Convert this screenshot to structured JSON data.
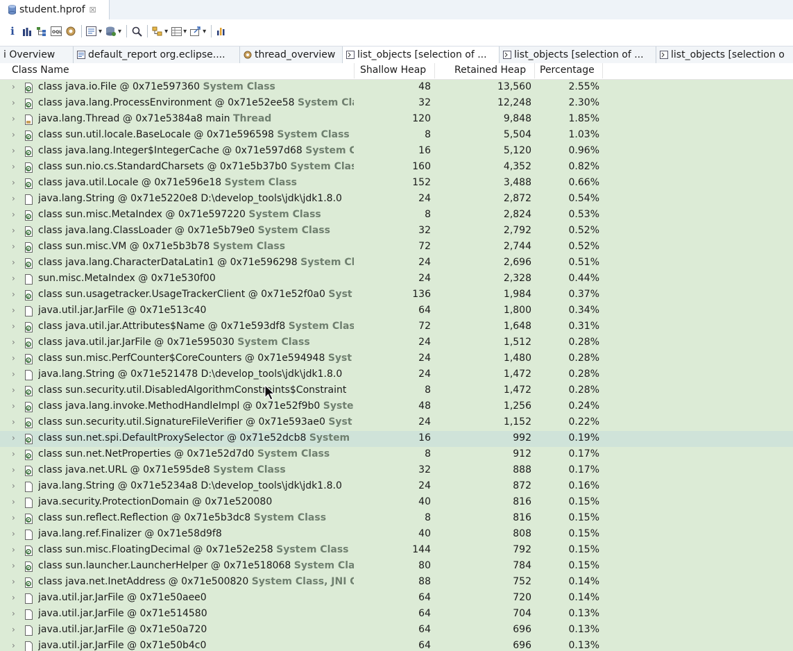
{
  "editor_tab": {
    "title": "student.hprof",
    "close_glyph": "☒"
  },
  "toolbar": {
    "items": [
      "info-icon",
      "histogram-icon",
      "dominator-tree-icon",
      "oql-icon",
      "thread-overview-icon",
      "run-report-icon",
      "query-browser-icon",
      "find-object-icon",
      "group-by-icon",
      "calculate-heap-icon",
      "export-icon",
      "overview-icon"
    ],
    "info_glyph": "i"
  },
  "result_tabs": [
    {
      "label": "i Overview",
      "icon": "info-icon"
    },
    {
      "label": "default_report  org.eclipse....",
      "icon": "report-icon"
    },
    {
      "label": "thread_overview",
      "icon": "gear-icon"
    },
    {
      "label": "list_objects  [selection of ...",
      "icon": "list-icon",
      "active": true
    },
    {
      "label": "list_objects  [selection of ...",
      "icon": "list-icon"
    },
    {
      "label": "list_objects  [selection o",
      "icon": "list-icon"
    }
  ],
  "columns": {
    "class_name": "Class Name",
    "shallow_heap": "Shallow Heap",
    "retained_heap": "Retained Heap",
    "percentage": "Percentage"
  },
  "rows": [
    {
      "name": "class java.io.File @ 0x71e597360",
      "extra": "System Class",
      "shallow": "48",
      "retained": "13,560",
      "pct": "2.55%",
      "kind": "class"
    },
    {
      "name": "class java.lang.ProcessEnvironment @ 0x71e52ee58",
      "extra": "System Cla",
      "shallow": "32",
      "retained": "12,248",
      "pct": "2.30%",
      "kind": "class"
    },
    {
      "name": "java.lang.Thread @ 0x71e5384a8  main",
      "extra": "Thread",
      "shallow": "120",
      "retained": "9,848",
      "pct": "1.85%",
      "kind": "thread"
    },
    {
      "name": "class sun.util.locale.BaseLocale @ 0x71e596598",
      "extra": "System Class",
      "shallow": "8",
      "retained": "5,504",
      "pct": "1.03%",
      "kind": "class"
    },
    {
      "name": "class java.lang.Integer$IntegerCache @ 0x71e597d68",
      "extra": "System C",
      "shallow": "16",
      "retained": "5,120",
      "pct": "0.96%",
      "kind": "class"
    },
    {
      "name": "class sun.nio.cs.StandardCharsets @ 0x71e5b37b0",
      "extra": "System Clas",
      "shallow": "160",
      "retained": "4,352",
      "pct": "0.82%",
      "kind": "class"
    },
    {
      "name": "class java.util.Locale @ 0x71e596e18",
      "extra": "System Class",
      "shallow": "152",
      "retained": "3,488",
      "pct": "0.66%",
      "kind": "class"
    },
    {
      "name": "java.lang.String @ 0x71e5220e8  D:\\develop_tools\\jdk\\jdk1.8.0",
      "extra": "",
      "shallow": "24",
      "retained": "2,872",
      "pct": "0.54%",
      "kind": "object"
    },
    {
      "name": "class sun.misc.MetaIndex @ 0x71e597220",
      "extra": "System Class",
      "shallow": "8",
      "retained": "2,824",
      "pct": "0.53%",
      "kind": "class"
    },
    {
      "name": "class java.lang.ClassLoader @ 0x71e5b79e0",
      "extra": "System Class",
      "shallow": "32",
      "retained": "2,792",
      "pct": "0.52%",
      "kind": "class"
    },
    {
      "name": "class sun.misc.VM @ 0x71e5b3b78",
      "extra": "System Class",
      "shallow": "72",
      "retained": "2,744",
      "pct": "0.52%",
      "kind": "class"
    },
    {
      "name": "class java.lang.CharacterDataLatin1 @ 0x71e596298",
      "extra": "System Cla",
      "shallow": "24",
      "retained": "2,696",
      "pct": "0.51%",
      "kind": "class"
    },
    {
      "name": "sun.misc.MetaIndex @ 0x71e530f00",
      "extra": "",
      "shallow": "24",
      "retained": "2,328",
      "pct": "0.44%",
      "kind": "object"
    },
    {
      "name": "class sun.usagetracker.UsageTrackerClient @ 0x71e52f0a0",
      "extra": "Syst",
      "shallow": "136",
      "retained": "1,984",
      "pct": "0.37%",
      "kind": "class"
    },
    {
      "name": "java.util.jar.JarFile @ 0x71e513c40",
      "extra": "",
      "shallow": "64",
      "retained": "1,800",
      "pct": "0.34%",
      "kind": "object"
    },
    {
      "name": "class java.util.jar.Attributes$Name @ 0x71e593df8",
      "extra": "System Clas",
      "shallow": "72",
      "retained": "1,648",
      "pct": "0.31%",
      "kind": "class"
    },
    {
      "name": "class java.util.jar.JarFile @ 0x71e595030",
      "extra": "System Class",
      "shallow": "24",
      "retained": "1,512",
      "pct": "0.28%",
      "kind": "class"
    },
    {
      "name": "class sun.misc.PerfCounter$CoreCounters @ 0x71e594948",
      "extra": "Syst",
      "shallow": "24",
      "retained": "1,480",
      "pct": "0.28%",
      "kind": "class"
    },
    {
      "name": "java.lang.String @ 0x71e521478  D:\\develop_tools\\jdk\\jdk1.8.0",
      "extra": "",
      "shallow": "24",
      "retained": "1,472",
      "pct": "0.28%",
      "kind": "object"
    },
    {
      "name": "class sun.security.util.DisabledAlgorithmConstraints$Constraint",
      "extra": "",
      "shallow": "8",
      "retained": "1,472",
      "pct": "0.28%",
      "kind": "class"
    },
    {
      "name": "class java.lang.invoke.MethodHandleImpl @ 0x71e52f9b0",
      "extra": "Syste",
      "shallow": "48",
      "retained": "1,256",
      "pct": "0.24%",
      "kind": "class"
    },
    {
      "name": "class sun.security.util.SignatureFileVerifier @ 0x71e593ae0",
      "extra": "Syst",
      "shallow": "24",
      "retained": "1,152",
      "pct": "0.22%",
      "kind": "class"
    },
    {
      "name": "class sun.net.spi.DefaultProxySelector @ 0x71e52dcb8",
      "extra": "System",
      "shallow": "16",
      "retained": "992",
      "pct": "0.19%",
      "kind": "class",
      "selected": true
    },
    {
      "name": "class sun.net.NetProperties @ 0x71e52d7d0",
      "extra": "System Class",
      "shallow": "8",
      "retained": "912",
      "pct": "0.17%",
      "kind": "class"
    },
    {
      "name": "class java.net.URL @ 0x71e595de8",
      "extra": "System Class",
      "shallow": "32",
      "retained": "888",
      "pct": "0.17%",
      "kind": "class"
    },
    {
      "name": "java.lang.String @ 0x71e5234a8  D:\\develop_tools\\jdk\\jdk1.8.0",
      "extra": "",
      "shallow": "24",
      "retained": "872",
      "pct": "0.16%",
      "kind": "object"
    },
    {
      "name": "java.security.ProtectionDomain @ 0x71e520080",
      "extra": "",
      "shallow": "40",
      "retained": "816",
      "pct": "0.15%",
      "kind": "object"
    },
    {
      "name": "class sun.reflect.Reflection @ 0x71e5b3dc8",
      "extra": "System Class",
      "shallow": "8",
      "retained": "816",
      "pct": "0.15%",
      "kind": "class"
    },
    {
      "name": "java.lang.ref.Finalizer @ 0x71e58d9f8",
      "extra": "",
      "shallow": "40",
      "retained": "808",
      "pct": "0.15%",
      "kind": "object"
    },
    {
      "name": "class sun.misc.FloatingDecimal @ 0x71e52e258",
      "extra": "System Class",
      "shallow": "144",
      "retained": "792",
      "pct": "0.15%",
      "kind": "class"
    },
    {
      "name": "class sun.launcher.LauncherHelper @ 0x71e518068",
      "extra": "System Cla",
      "shallow": "80",
      "retained": "784",
      "pct": "0.15%",
      "kind": "class"
    },
    {
      "name": "class java.net.InetAddress @ 0x71e500820",
      "extra": "System Class, JNI G",
      "shallow": "88",
      "retained": "752",
      "pct": "0.14%",
      "kind": "class"
    },
    {
      "name": "java.util.jar.JarFile @ 0x71e50aee0",
      "extra": "",
      "shallow": "64",
      "retained": "720",
      "pct": "0.14%",
      "kind": "object"
    },
    {
      "name": "java.util.jar.JarFile @ 0x71e514580",
      "extra": "",
      "shallow": "64",
      "retained": "704",
      "pct": "0.13%",
      "kind": "object"
    },
    {
      "name": "java.util.jar.JarFile @ 0x71e50a720",
      "extra": "",
      "shallow": "64",
      "retained": "696",
      "pct": "0.13%",
      "kind": "object"
    },
    {
      "name": "java.util.jar.JarFile @ 0x71e50b4c0",
      "extra": "",
      "shallow": "64",
      "retained": "696",
      "pct": "0.13%",
      "kind": "object"
    }
  ],
  "expand_glyph": "›",
  "colors": {
    "row_bg": "#dcebd6",
    "selected_bg": "#cfe3d9",
    "extra_text": "#6f7f6f"
  }
}
